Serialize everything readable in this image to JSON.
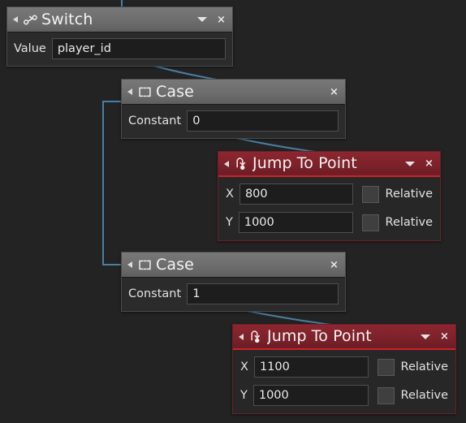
{
  "canvas": {
    "background_color": "#232323",
    "wire_color": "#4a7fa5"
  },
  "nodes": [
    {
      "id": "switch",
      "title": "Switch",
      "icon": "switch-icon",
      "header_color": "#6e6e6e",
      "has_caret": true,
      "has_close": true,
      "close_label": "×",
      "collapse_label": "◂",
      "fields": [
        {
          "label": "Value",
          "value": "player_id",
          "type": "text"
        }
      ]
    },
    {
      "id": "case-0",
      "title": "Case",
      "icon": "case-bracket-icon",
      "header_color": "#6e6e6e",
      "has_caret": false,
      "has_close": true,
      "close_label": "×",
      "collapse_label": "◂",
      "fields": [
        {
          "label": "Constant",
          "value": "0",
          "type": "text"
        }
      ]
    },
    {
      "id": "jump-0",
      "title": "Jump To Point",
      "icon": "jump-to-point-icon",
      "header_color": "#7e222b",
      "accent_color": "#d0202c",
      "has_caret": true,
      "has_close": true,
      "close_label": "×",
      "collapse_label": "◂",
      "fields": [
        {
          "label": "X",
          "value": "800",
          "type": "text",
          "checkbox_label": "Relative",
          "checked": false
        },
        {
          "label": "Y",
          "value": "1000",
          "type": "text",
          "checkbox_label": "Relative",
          "checked": false
        }
      ]
    },
    {
      "id": "case-1",
      "title": "Case",
      "icon": "case-bracket-icon",
      "header_color": "#6e6e6e",
      "has_caret": false,
      "has_close": true,
      "close_label": "×",
      "collapse_label": "◂",
      "fields": [
        {
          "label": "Constant",
          "value": "1",
          "type": "text"
        }
      ]
    },
    {
      "id": "jump-1",
      "title": "Jump To Point",
      "icon": "jump-to-point-icon",
      "header_color": "#7e222b",
      "accent_color": "#d0202c",
      "has_caret": true,
      "has_close": true,
      "close_label": "×",
      "collapse_label": "◂",
      "fields": [
        {
          "label": "X",
          "value": "1100",
          "type": "text",
          "checkbox_label": "Relative",
          "checked": false
        },
        {
          "label": "Y",
          "value": "1000",
          "type": "text",
          "checkbox_label": "Relative",
          "checked": false
        }
      ]
    }
  ]
}
